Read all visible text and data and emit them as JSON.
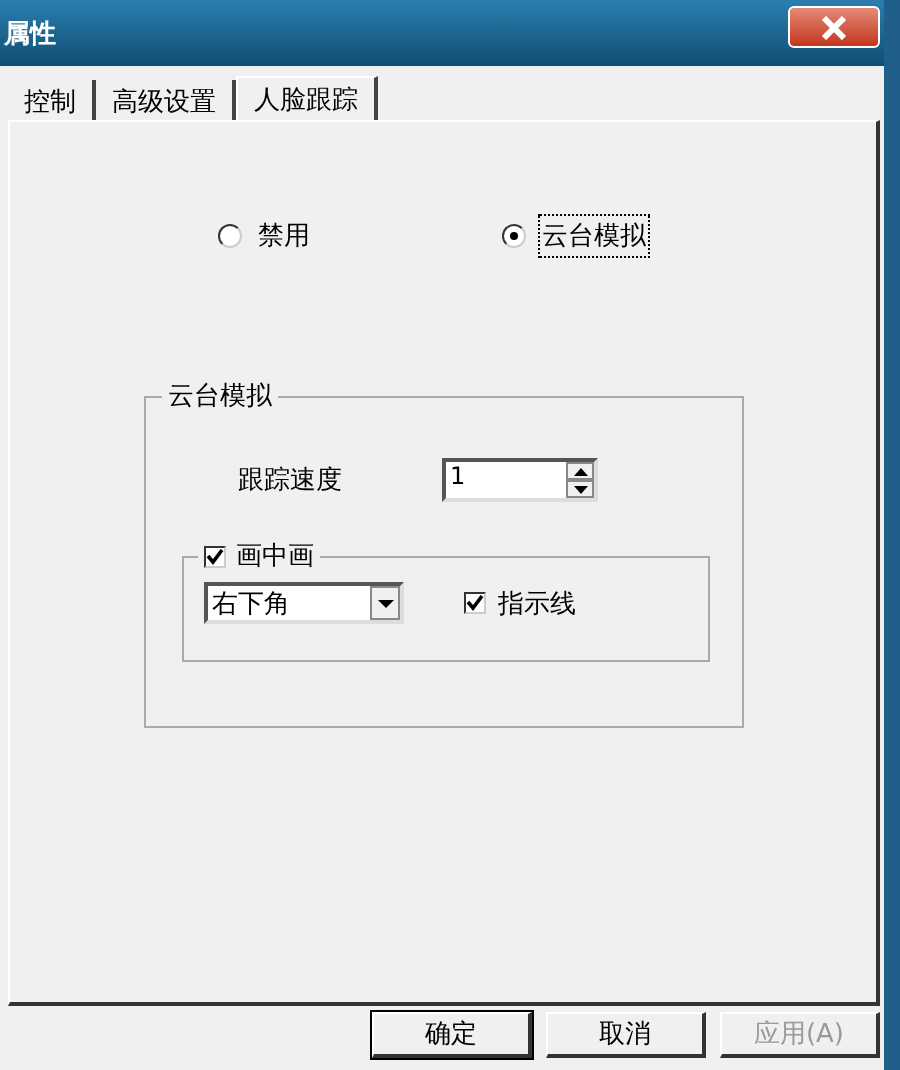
{
  "window": {
    "title": "属性"
  },
  "tabs": [
    {
      "label": "控制",
      "selected": false
    },
    {
      "label": "高级设置",
      "selected": false
    },
    {
      "label": "人脸跟踪",
      "selected": true
    }
  ],
  "mode_options": [
    {
      "label": "禁用",
      "selected": false
    },
    {
      "label": "云台模拟",
      "selected": true
    }
  ],
  "ptz_group": {
    "title": "云台模拟",
    "speed_label": "跟踪速度",
    "speed_value": "1",
    "pip": {
      "label": "画中画",
      "checked": true,
      "position": "右下角",
      "indicator": {
        "label": "指示线",
        "checked": true
      }
    }
  },
  "buttons": [
    {
      "label": "确定",
      "disabled": false,
      "default": true
    },
    {
      "label": "取消",
      "disabled": false,
      "default": false
    },
    {
      "label": "应用(A)",
      "disabled": true,
      "default": false
    }
  ]
}
